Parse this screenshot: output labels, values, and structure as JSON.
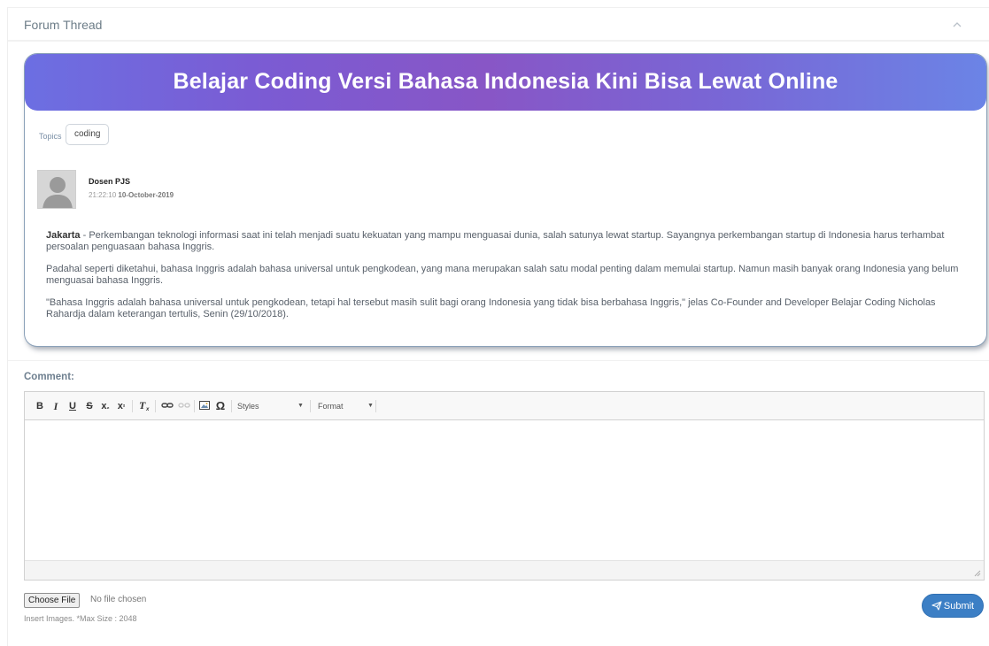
{
  "panel": {
    "title": "Forum Thread",
    "collapse_icon": "chevron-up-icon"
  },
  "thread": {
    "title": "Belajar Coding Versi Bahasa Indonesia Kini Bisa Lewat Online",
    "banner_colors": [
      "#6c6fe2",
      "#8856c6",
      "#6b84e6"
    ],
    "topics_label": "Topics",
    "topics": [
      "coding"
    ],
    "author": {
      "name": "Dosen PJS",
      "time": "21:22:10",
      "date": "10-October-2019",
      "avatar_icon": "user-avatar-icon"
    },
    "body": {
      "city": "Jakarta",
      "p1_rest": " - Perkembangan teknologi informasi saat ini telah menjadi suatu kekuatan yang mampu menguasai dunia, salah satunya lewat startup. Sayangnya perkembangan startup di Indonesia harus terhambat persoalan penguasaan bahasa Inggris.",
      "p2": "Padahal seperti diketahui, bahasa Inggris adalah bahasa universal untuk pengkodean, yang mana merupakan salah satu modal penting dalam memulai startup. Namun masih banyak orang Indonesia yang belum menguasai bahasa Inggris.",
      "p3": "\"Bahasa Inggris adalah bahasa universal untuk pengkodean, tetapi hal tersebut masih sulit bagi orang Indonesia yang tidak bisa berbahasa Inggris,\" jelas Co-Founder and Developer Belajar Coding Nicholas Rahardja dalam keterangan tertulis, Senin (29/10/2018)."
    }
  },
  "comment": {
    "label": "Comment:",
    "toolbar": {
      "bold": "B",
      "italic": "I",
      "underline": "U",
      "strike": "S",
      "subscript": "x",
      "superscript": "x",
      "styles": "Styles",
      "format": "Format",
      "icons": [
        "bold-icon",
        "italic-icon",
        "underline-icon",
        "strikethrough-icon",
        "subscript-icon",
        "superscript-icon",
        "remove-format-icon",
        "link-icon",
        "unlink-icon",
        "image-icon",
        "special-char-icon"
      ]
    },
    "choose_file_label": "Choose File",
    "file_status": "No file chosen",
    "file_hint": "Insert Images. *Max Size : 2048",
    "submit_label": "Submit",
    "submit_color": "#3c7fc5"
  }
}
